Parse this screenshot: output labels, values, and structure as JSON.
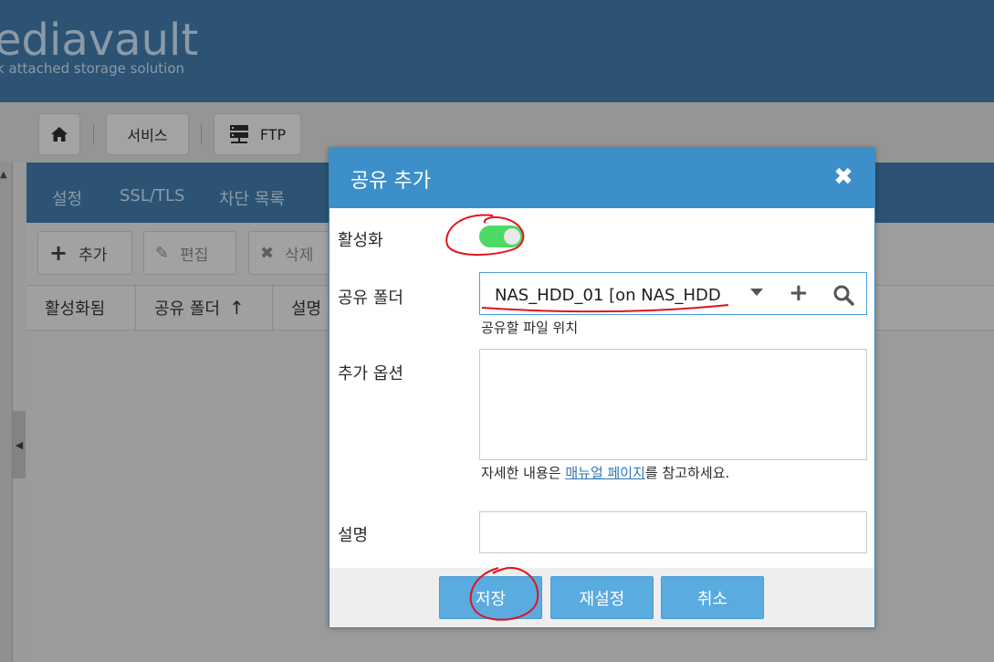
{
  "header": {
    "logo_text": "ediavault",
    "logo_subtext": "k attached storage solution"
  },
  "breadcrumb": {
    "home_icon": "home-icon",
    "service_label": "서비스",
    "ftp_icon": "server-icon",
    "ftp_label": "FTP"
  },
  "panel": {
    "tabs": [
      {
        "label": "설정"
      },
      {
        "label": "SSL/TLS"
      },
      {
        "label": "차단 목록"
      }
    ],
    "toolbar": {
      "add_label": "추가",
      "edit_label": "편집",
      "delete_label": "삭제"
    },
    "columns": [
      {
        "label": "활성화됨"
      },
      {
        "label": "공유 폴더"
      },
      {
        "label": "설명"
      }
    ]
  },
  "modal": {
    "title": "공유 추가",
    "close_icon": "close-icon",
    "enable_label": "활성화",
    "enable_state": true,
    "shared_folder_label": "공유 폴더",
    "shared_folder_value": "NAS_HDD_01 [on NAS_HDD",
    "shared_folder_hint": "공유할 파일 위치",
    "extra_options_label": "추가 옵션",
    "extra_options_value": "",
    "extra_options_hint_prefix": "자세한 내용은 ",
    "extra_options_hint_link": "매뉴얼 페이지",
    "extra_options_hint_suffix": "를 참고하세요.",
    "description_label": "설명",
    "description_value": "",
    "buttons": {
      "save": "저장",
      "reset": "재설정",
      "cancel": "취소"
    }
  },
  "colors": {
    "modal_header": "#3d8fc9",
    "button": "#5aabe0",
    "toggle_on": "#4cd964",
    "annotation": "#e0141e"
  }
}
